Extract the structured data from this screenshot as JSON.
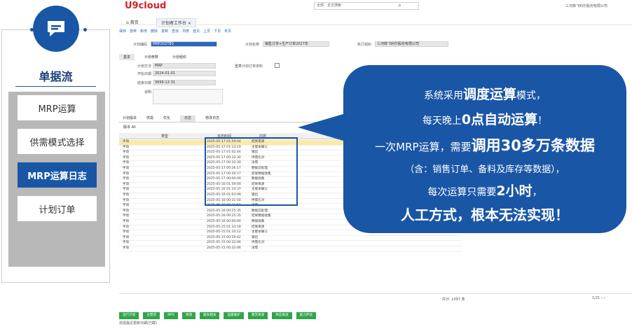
{
  "left_panel": {
    "title": "单据流",
    "items": [
      {
        "label": "MRP运算",
        "active": false
      },
      {
        "label": "供需模式选择",
        "active": false
      },
      {
        "label": "MRP运算日志",
        "active": true
      },
      {
        "label": "计划订单",
        "active": false
      }
    ]
  },
  "app": {
    "logo": "U9cloud",
    "search_scope": "全部",
    "search_placeholder": "全文搜索",
    "company": "三河菲飞利尔股份有限公司",
    "tabs": {
      "home": "首页",
      "current": "计划者工作台"
    },
    "toolbar": [
      "保存",
      "放弃",
      "新增",
      "删除",
      "复制",
      "查找",
      "列表",
      "首页",
      "上页",
      "下页",
      "末页"
    ],
    "form": {
      "plan_code_label": "计划编码",
      "plan_code_value": "MRP202T80",
      "plan_name_label": "计划名称",
      "plan_name_value": "销售订单+生产订单2027年",
      "exec_org_label": "执行组织",
      "exec_org_value": "三河菲飞利尔股份有限公司",
      "subtabs": [
        "基本",
        "计划参数",
        "计划组织"
      ],
      "plan_method_label": "计划方法",
      "plan_method_value": "MRP",
      "reset_label": "重算计划订单资料",
      "start_label": "开始日期",
      "start_value": "2024-01-01",
      "end_label": "结束日期",
      "end_value": "9999-12-31",
      "desc_label": "说明"
    },
    "bottom_tabs": [
      "计划版本",
      "供需",
      "优化",
      "日志",
      "修改日志"
    ],
    "version_label": "版本 All",
    "grid": {
      "headers": [
        "类型",
        "日志时间",
        "内容"
      ],
      "rows": [
        [
          "手动",
          "2025-05-17 01:59:04",
          "结果来源"
        ],
        [
          "手动",
          "2025-05-17 01:13:19",
          "主版本确认"
        ],
        [
          "手动",
          "2025-05-17 01:02:44",
          "输出"
        ],
        [
          "手动",
          "2025-05-17 00:32:30",
          "供需比对"
        ],
        [
          "手动",
          "2025-05-17 00:32:30",
          "净需"
        ],
        [
          "手动",
          "2025-05-17 00:26:17",
          "数据前处理"
        ],
        [
          "手动",
          "2025-05-17 00:26:17",
          "结果数据收集"
        ],
        [
          "手动",
          "2025-05-17 00:00:00",
          "数据收集"
        ],
        [
          "手动",
          "2025-05-16 01:59:00",
          "结果来源"
        ],
        [
          "手动",
          "2025-05-16 01:14:37",
          "主版本确认"
        ],
        [
          "手动",
          "2025-05-16 01:03:09",
          "输出"
        ],
        [
          "手动",
          "2025-05-16 00:31:50",
          "供需比对"
        ],
        [
          "手动",
          "2025-05-16 00:31:50",
          "净需"
        ],
        [
          "手动",
          "2025-05-16 00:25:35",
          "数据前处理"
        ],
        [
          "手动",
          "2025-05-16 00:25:35",
          "结果数据收集"
        ],
        [
          "手动",
          "2025-05-16 00:00:00",
          "数据收集"
        ],
        [
          "手动",
          "2025-05-15 01:33:18",
          "结果来源"
        ],
        [
          "手动",
          "2025-05-15 01:10:12",
          "主版本确认"
        ],
        [
          "手动",
          "2025-05-15 00:59:42",
          "输出"
        ],
        [
          "手动",
          "2025-05-15 00:32:06",
          "供需比对"
        ],
        [
          "手动",
          "2025-05-15 00:32:06",
          "净需"
        ]
      ],
      "total": "共计: 1097 条",
      "pager": "1/21 ‹ ›"
    },
    "green_buttons": [
      "运行计划",
      "主需求",
      "MPS",
      "预测",
      "版本相关",
      "运输维护",
      "需求来源",
      "供应来源",
      "能力评估"
    ],
    "status_text": "完成最近更新日期(已截)"
  },
  "bubble": {
    "line1_pre": "系统采用",
    "line1_bold": "调度运算",
    "line1_post": "模式，",
    "line2_pre": "每天晚上",
    "line2_bold": "0点自动运算",
    "line2_post": "！",
    "line3_pre": "一次MRP运算，需要",
    "line3_bold": "调用30多万条数据",
    "line4": "（含：销售订单、备料及库存等数据），",
    "line5_pre": "每次运算只需要",
    "line5_bold": "2小时",
    "line5_post": "，",
    "line6": "人工方式，根本无法实现！"
  },
  "colors": {
    "brand_blue": "#1a56a6",
    "highlight_row": "#fbe9a9",
    "green_button": "#2fa64a",
    "logo_red": "#d61f26"
  }
}
